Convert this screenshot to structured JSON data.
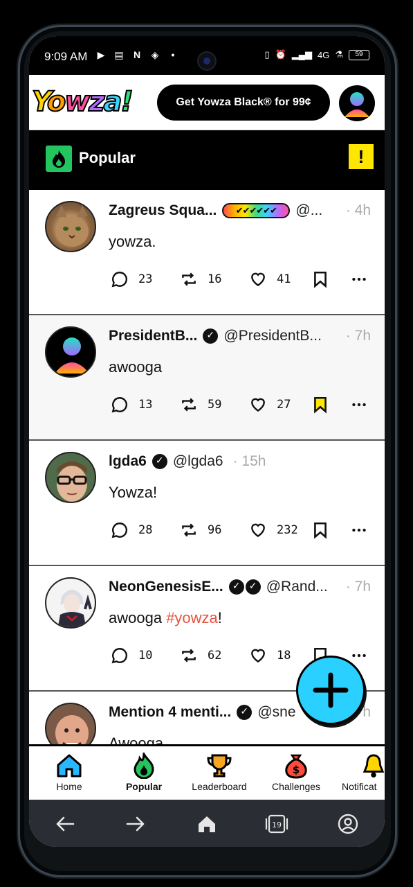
{
  "status_bar": {
    "time": "9:09 AM",
    "network": "4G",
    "battery": "59"
  },
  "header": {
    "logo_text": "Yowza!",
    "logo_letters": [
      "Y",
      "o",
      "w",
      "z",
      "a",
      "!"
    ],
    "promo_button": "Get Yowza Black® for 99¢"
  },
  "title_bar": {
    "title": "Popular",
    "warning_icon": "exclamation"
  },
  "posts": [
    {
      "name": "Zagreus Squa...",
      "handle": "@...",
      "time": "· 4h",
      "content": "yowza.",
      "badge": "✔✔✔✔✔✔",
      "comments": "23",
      "reposts": "16",
      "likes": "41",
      "bookmarked": false
    },
    {
      "name": "PresidentB...",
      "handle": "@PresidentB...",
      "time": "· 7h",
      "content": "awooga",
      "comments": "13",
      "reposts": "59",
      "likes": "27",
      "bookmarked": true
    },
    {
      "name": "lgda6",
      "handle": "@lgda6",
      "time": "· 15h",
      "content": "Yowza!",
      "comments": "28",
      "reposts": "96",
      "likes": "232",
      "bookmarked": false
    },
    {
      "name": "NeonGenesisE...",
      "handle": "@Rand...",
      "time": "· 7h",
      "content_prefix": "awooga ",
      "hashtag": "#yowza",
      "content_suffix": "!",
      "comments": "10",
      "reposts": "62",
      "likes": "18",
      "bookmarked": false
    },
    {
      "name": "Mention 4 menti...",
      "handle": "@sne",
      "time": "h",
      "content": "Awooga"
    }
  ],
  "bottom_nav": [
    {
      "label": "Home",
      "icon": "home-icon"
    },
    {
      "label": "Popular",
      "icon": "fire-icon"
    },
    {
      "label": "Leaderboard",
      "icon": "trophy-icon"
    },
    {
      "label": "Challenges",
      "icon": "money-bag-icon"
    },
    {
      "label": "Notificat",
      "icon": "bell-icon"
    }
  ],
  "system_nav": {
    "tab_count": "19"
  },
  "colors": {
    "accent_green": "#22c55e",
    "warning_yellow": "#ffe600",
    "fab_cyan": "#2ad0ff",
    "hashtag_red": "#e8533f",
    "bookmark_active": "#ffe600"
  }
}
